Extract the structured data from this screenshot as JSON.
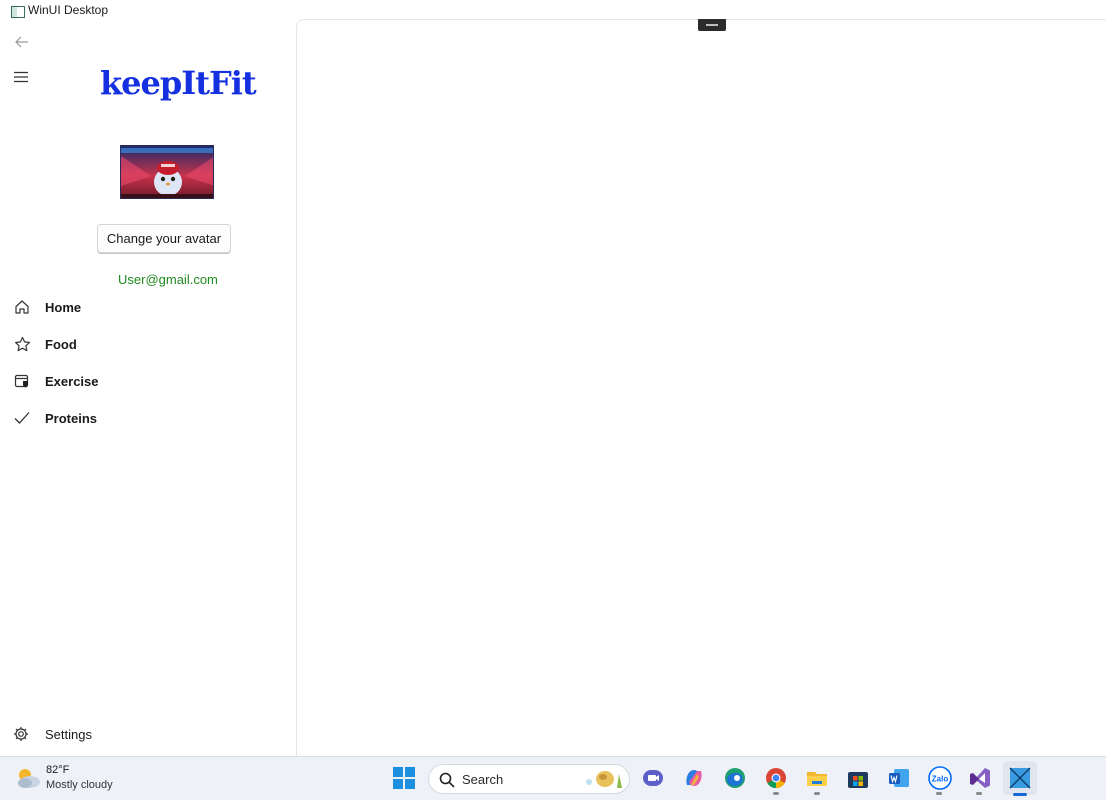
{
  "window": {
    "title": "WinUI Desktop"
  },
  "app": {
    "logo_text": "keepItFit"
  },
  "profile": {
    "change_avatar_label": "Change your avatar",
    "email": "User@gmail.com"
  },
  "nav": {
    "items": [
      {
        "label": "Home",
        "icon": "home-icon"
      },
      {
        "label": "Food",
        "icon": "star-icon"
      },
      {
        "label": "Exercise",
        "icon": "calendar-shield-icon"
      },
      {
        "label": "Proteins",
        "icon": "checkmark-icon"
      }
    ],
    "settings_label": "Settings"
  },
  "taskbar": {
    "weather": {
      "temp": "82°F",
      "condition": "Mostly cloudy"
    },
    "search_label": "Search",
    "apps": [
      "windows-start",
      "search",
      "teams-meet",
      "copilot",
      "edge",
      "chrome",
      "file-explorer",
      "microsoft-store",
      "word",
      "zalo",
      "visual-studio",
      "winui-app"
    ],
    "zalo_text": "Zalo"
  },
  "colors": {
    "logo": "#1430e0",
    "email": "#1f8a1f",
    "taskbar_bg": "#eef2f8",
    "accent": "#1668d8"
  }
}
